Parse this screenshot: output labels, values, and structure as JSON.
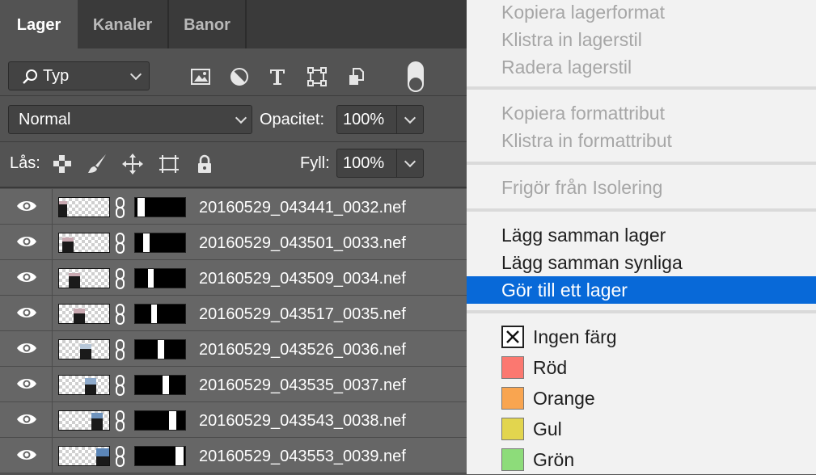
{
  "tabs": [
    "Lager",
    "Kanaler",
    "Banor"
  ],
  "filter": {
    "label": "Typ",
    "icons": [
      "search-icon",
      "image-filter-icon",
      "adjustment-filter-icon",
      "type-filter-icon",
      "shape-filter-icon",
      "smart-object-filter-icon",
      "filter-toggle-switch"
    ]
  },
  "blend_mode": "Normal",
  "opacity": {
    "label": "Opacitet:",
    "value": "100%"
  },
  "lock": {
    "label": "Lås:",
    "icons": [
      "lock-transparent-pixels-icon",
      "lock-image-pixels-icon",
      "lock-position-icon",
      "lock-artboard-icon",
      "lock-all-icon"
    ]
  },
  "fill": {
    "label": "Fyll:",
    "value": "100%"
  },
  "layers": [
    {
      "name": "20160529_043441_0032.nef"
    },
    {
      "name": "20160529_043501_0033.nef"
    },
    {
      "name": "20160529_043509_0034.nef"
    },
    {
      "name": "20160529_043517_0035.nef"
    },
    {
      "name": "20160529_043526_0036.nef"
    },
    {
      "name": "20160529_043535_0037.nef"
    },
    {
      "name": "20160529_043543_0038.nef"
    },
    {
      "name": "20160529_043553_0039.nef"
    }
  ],
  "menu": {
    "group1": [
      "Kopiera lagerformat",
      "Klistra in lagerstil",
      "Radera lagerstil"
    ],
    "group2": [
      "Kopiera formattribut",
      "Klistra in formattribut"
    ],
    "group3": [
      "Frigör från Isolering"
    ],
    "group4": [
      "Lägg samman lager",
      "Lägg samman synliga",
      "Gör till ett lager"
    ],
    "colors": [
      {
        "label": "Ingen färg",
        "color": "none"
      },
      {
        "label": "Röd",
        "color": "#fb7870"
      },
      {
        "label": "Orange",
        "color": "#f9a550"
      },
      {
        "label": "Gul",
        "color": "#e2d54e"
      },
      {
        "label": "Grön",
        "color": "#8ddc7a"
      }
    ]
  },
  "colors": {
    "panel": "#535353",
    "tabbar": "#3a3a3a",
    "row": "#666666",
    "menu_bg": "#f2f2f2",
    "highlight": "#0869d8"
  }
}
